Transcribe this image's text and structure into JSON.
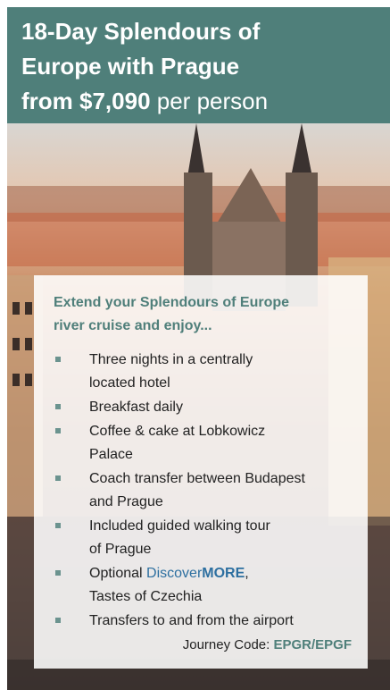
{
  "header": {
    "line1": "18-Day Splendours of",
    "line2": "Europe with Prague",
    "price": "from $7,090",
    "per_person": "per person"
  },
  "panel": {
    "intro_line1": "Extend your Splendours of Europe",
    "intro_line2": "river cruise and enjoy...",
    "items": [
      {
        "line1": "Three nights in a centrally",
        "line2": "located hotel"
      },
      {
        "line1": "Breakfast daily"
      },
      {
        "line1": "Coffee & cake at Lobkowicz",
        "line2": "Palace"
      },
      {
        "line1": "Coach transfer between Budapest",
        "line2": "and Prague"
      },
      {
        "line1": "Included guided walking tour",
        "line2": "of Prague"
      },
      {
        "pre": "Optional ",
        "discover": "Discover",
        "more": "MORE",
        "post": ",",
        "line2": "Tastes of Czechia"
      },
      {
        "line1": "Transfers to and from the airport"
      }
    ],
    "journey_label": "Journey Code: ",
    "journey_code": "EPGR/EPGF"
  },
  "colors": {
    "header_bg": "#4f7f7a",
    "accent_text": "#4f7f7a",
    "link_blue": "#2d6fa0"
  },
  "image": {
    "subject": "Prague Old Town Square with Church of Our Lady before Týn"
  }
}
